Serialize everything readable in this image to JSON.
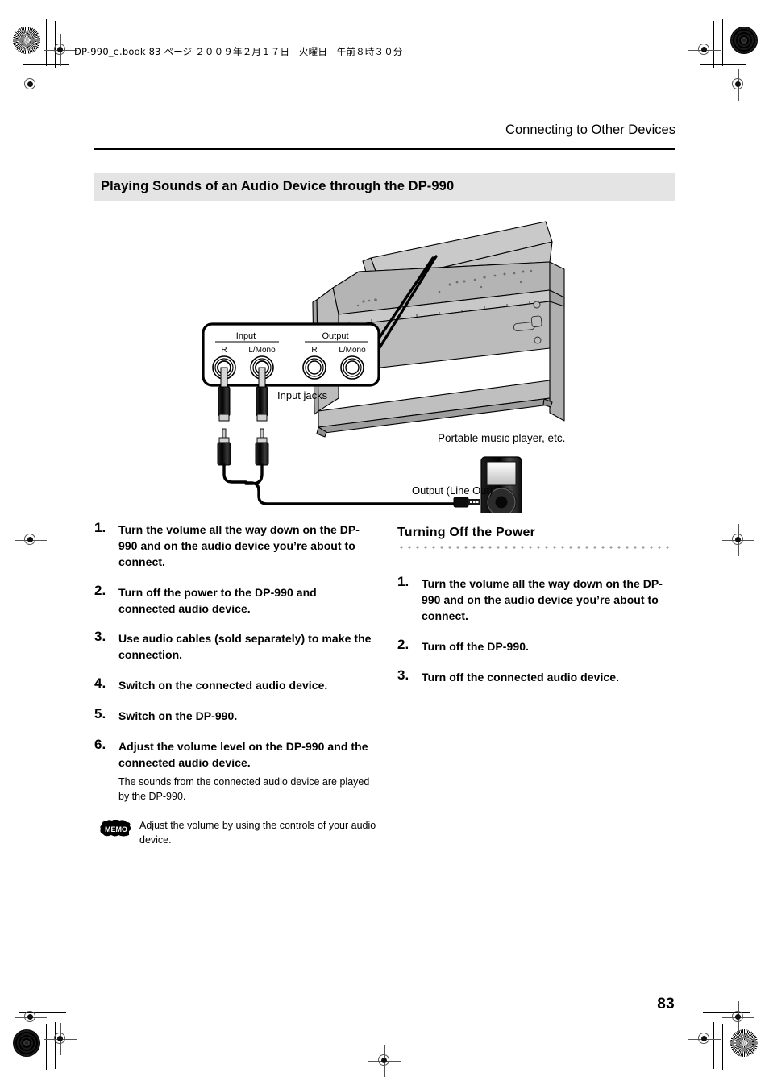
{
  "print_header": {
    "file_line": "DP-990_e.book  83 ページ  ２００９年２月１７日　火曜日　午前８時３０分"
  },
  "running_head": "Connecting to Other Devices",
  "section": {
    "title": "Playing Sounds of an Audio Device through the DP-990"
  },
  "figure": {
    "panel": {
      "input_group": "Input",
      "output_group": "Output",
      "input_r": "R",
      "input_lmono": "L/Mono",
      "output_r": "R",
      "output_lmono": "L/Mono"
    },
    "labels": {
      "input_jacks": "Input jacks",
      "player": "Portable music player, etc.",
      "line_out": "Output (Line Out)"
    }
  },
  "left_column": {
    "steps": [
      {
        "number": "1.",
        "title": "Turn the volume all the way down on the DP-990 and on the audio device you’re about to connect."
      },
      {
        "number": "2.",
        "title": "Turn off the power to the DP-990 and connected audio device."
      },
      {
        "number": "3.",
        "title": "Use audio cables (sold separately) to make the connection."
      },
      {
        "number": "4.",
        "title": "Switch on the connected audio device."
      },
      {
        "number": "5.",
        "title": "Switch on the DP-990."
      },
      {
        "number": "6.",
        "title": "Adjust the volume level on the DP-990 and the connected audio device.",
        "body": "The sounds from the connected audio device are played by the DP-990."
      }
    ],
    "memo": {
      "icon_label": "MEMO",
      "text": "Adjust the volume by using the controls of your audio device."
    }
  },
  "right_column": {
    "heading": "Turning Off the Power",
    "steps": [
      {
        "number": "1.",
        "title": "Turn the volume all the way down on the DP-990 and on the audio device you’re about to connect."
      },
      {
        "number": "2.",
        "title": "Turn off the DP-990."
      },
      {
        "number": "3.",
        "title": "Turn off the connected audio device."
      }
    ]
  },
  "page_number": "83",
  "colors": {
    "band": "#e4e4e4",
    "rule": "#000000",
    "dot_rule": "#9a9a9a",
    "illustration_gray": "#b2b2b2"
  }
}
